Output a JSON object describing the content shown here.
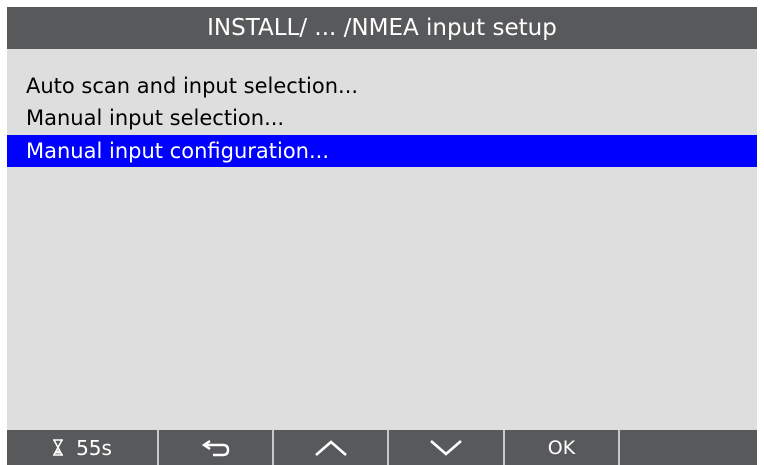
{
  "title": "INSTALL/ ... /NMEA input setup",
  "menu": {
    "items": [
      {
        "label": "Auto scan and input selection..."
      },
      {
        "label": "Manual input selection..."
      },
      {
        "label": "Manual input configuration...",
        "selected": true
      }
    ]
  },
  "soft_keys": {
    "timer_icon": "hourglass-icon",
    "timer": "55s",
    "back_icon": "return-arrow-icon",
    "up_icon": "chevron-up-icon",
    "down_icon": "chevron-down-icon",
    "ok_label": "OK"
  },
  "colors": {
    "title_bar": "#58595b",
    "background": "#dedede",
    "selection": "#0000ff",
    "soft_key_bar": "#58595b"
  }
}
